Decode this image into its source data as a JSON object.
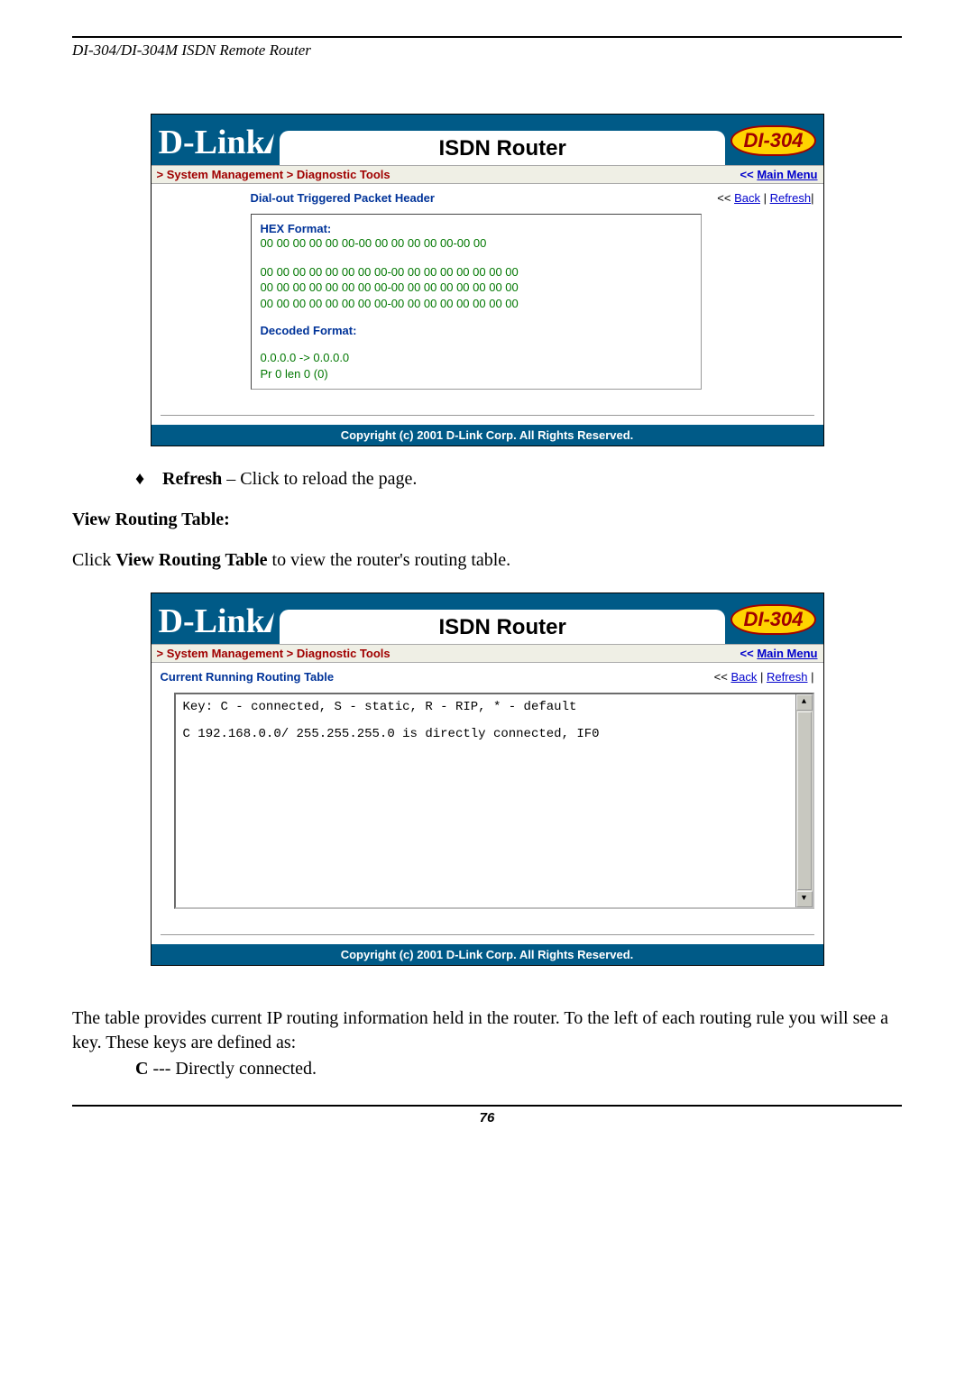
{
  "header": "DI-304/DI-304M ISDN Remote Router",
  "page_number": "76",
  "box1": {
    "logo": "D-Link",
    "title": "ISDN Router",
    "model": "DI-304",
    "breadcrumb": "> System Management > Diagnostic Tools",
    "main_menu": "Main Menu",
    "main_menu_prefix": "<< ",
    "section_title": "Dial-out Triggered Packet Header",
    "back": "Back",
    "refresh": "Refresh",
    "hex_label": "HEX Format:",
    "hex_line1": "00 00 00 00 00 00-00 00 00 00 00 00-00 00",
    "hex_line2": "00 00 00 00 00 00 00 00-00 00 00 00 00 00 00 00",
    "hex_line3": "00 00 00 00 00 00 00 00-00 00 00 00 00 00 00 00",
    "hex_line4": "00 00 00 00 00 00 00 00-00 00 00 00 00 00 00 00",
    "decoded_label": "Decoded Format:",
    "decoded_line1": "0.0.0.0 -> 0.0.0.0",
    "decoded_line2": "Pr 0 len 0 (0)",
    "copyright": "Copyright (c) 2001 D-Link Corp. All Rights Reserved."
  },
  "bullet_refresh_bold": "Refresh",
  "bullet_refresh_rest": " – Click to reload the page.",
  "subheading": "View Routing Table:",
  "instr_pre": "Click ",
  "instr_bold": "View Routing Table",
  "instr_post": " to view the router's routing table.",
  "box2": {
    "logo": "D-Link",
    "title": "ISDN Router",
    "model": "DI-304",
    "breadcrumb": "> System Management > Diagnostic Tools",
    "main_menu": "Main Menu",
    "main_menu_prefix": "<< ",
    "section_title": "Current Running Routing Table",
    "back": "Back",
    "refresh": "Refresh",
    "key_line": "Key: C - connected, S - static, R - RIP, * - default",
    "route_line": "C       192.168.0.0/   255.255.255.0 is directly connected, IF0",
    "copyright": "Copyright (c) 2001 D-Link Corp. All Rights Reserved."
  },
  "para_after": "The table provides current IP routing information held in the router. To the left of each routing rule you will see a key. These keys are defined as:",
  "key_c_bold": "C",
  "key_c_rest": " --- Directly connected."
}
